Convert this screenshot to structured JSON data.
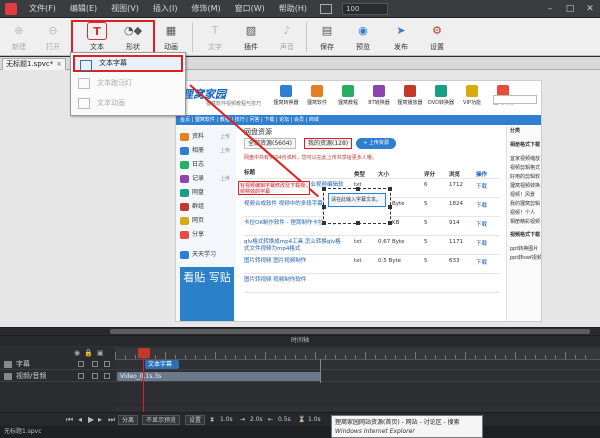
{
  "menubar": {
    "items": [
      "文件(F)",
      "编辑(E)",
      "视图(V)",
      "插入(I)",
      "修饰(M)",
      "窗口(W)",
      "帮助(H)"
    ],
    "zoom": "100"
  },
  "toolbar": {
    "new_label": "新建",
    "open_label": "打开",
    "text_label": "文本",
    "shape_label": "形状",
    "anim_label": "动画",
    "font_label": "文字",
    "image_label": "插件",
    "audio_label": "声音",
    "save_label": "保存",
    "preview_label": "预览",
    "publish_label": "发布",
    "settings_label": "设置"
  },
  "doc_tab": {
    "name": "无标题1.spvc*"
  },
  "dropdown": {
    "items": [
      "文本字幕",
      "文本跑马灯",
      "文本动画"
    ]
  },
  "web": {
    "logo": "狸窝家园",
    "subtitle": "狸窝软件视频教程与技巧",
    "nav_icons": [
      "狸窝转换器",
      "狸窝软件",
      "狸窝教程",
      "BT转换器",
      "狸窝播放器",
      "DVD转换器",
      "VIP功能",
      "狸窝商城"
    ],
    "nav_bar": "首页  |  狸窝软件  |  教程  |  技巧  |  问答  |  下载  |  论坛  |  会员  |  商城",
    "sidebar": [
      {
        "label": "资料",
        "hint": "上传"
      },
      {
        "label": "相册",
        "hint": "上传"
      },
      {
        "label": "日志",
        "hint": ""
      },
      {
        "label": "记录",
        "hint": "上传"
      },
      {
        "label": "网盘",
        "hint": ""
      },
      {
        "label": "群组",
        "hint": ""
      },
      {
        "label": "网页",
        "hint": ""
      },
      {
        "label": "分享",
        "hint": ""
      },
      {
        "label": "天天学习",
        "hint": ""
      }
    ],
    "banner": "看贴 写贴",
    "main_title": "网盘资源",
    "tabs": [
      "全部资源(5604)",
      "我的资源(128)"
    ],
    "upload_label": "+ 上传资源",
    "notice": "网盘中共有5604份资料，您可以在此上传共享给更多人哦。",
    "table_headers": [
      "标题",
      "类型",
      "大小",
      "评分",
      "浏览",
      "操作"
    ],
    "rows": [
      {
        "name": "免费视频编辑软件[狸窝] 专业视频编辑软件/视频编辑软件",
        "type": "txt",
        "size": "",
        "rate": "6",
        "views": "1712",
        "op": "下载"
      },
      {
        "name": "视频合成软件 视频中的多段字幕编辑",
        "type": "txt",
        "size": "0.65 Byte",
        "rate": "5",
        "views": "1824",
        "op": "下载"
      },
      {
        "name": "卡拉OK制作软件 - 狸窝制作卡拉OK字幕",
        "type": "txt",
        "size": "2.17 KB",
        "rate": "5",
        "views": "914",
        "op": "下载"
      },
      {
        "name": "qlv格式转换成mp4工具 怎么转换qlv格式文件视频为mp4格式",
        "type": "txt",
        "size": "0.67 Byte",
        "rate": "5",
        "views": "1171",
        "op": "下载"
      },
      {
        "name": "图片转视频 图片视频制作",
        "type": "txt",
        "size": "0.5 Byte",
        "rate": "5",
        "views": "633",
        "op": "下载"
      },
      {
        "name": "图片转视频 视频制作软件",
        "type": "",
        "size": "",
        "rate": "",
        "views": "",
        "op": ""
      }
    ],
    "right_title": "分类",
    "right_lines": [
      "相册格式下载",
      "宜家视频缩放",
      "视频剪辑格式",
      "好用的剪辑软",
      "狸窝视频转换",
      "视频！风景",
      "我的狸窝剪辑",
      "视频！个人",
      "相册精彩视频",
      "视频格式下载",
      "ppt转换图片",
      "ppt转swf视频"
    ]
  },
  "overlay": {
    "red_text": "有视频编辑字幕修改及下载视频特效的字幕",
    "caption_text": "请在此输入字幕文本。"
  },
  "timeline": {
    "title": "时间轴",
    "tracks": [
      "字幕",
      "视频/音频"
    ],
    "clip_caption": "文本字幕",
    "clip_video": "Video_0.1s.3s",
    "controls": [
      "分离",
      "不显示预览",
      "设置"
    ],
    "values": [
      "1.0s",
      "2.0s",
      "0.5s",
      "1.0s"
    ]
  },
  "statusbar": {
    "text": "无标题1.spvc"
  },
  "tooltip": {
    "line1": "狸窝家园网站资源(首页) - 网站 - 讨论区 - 搜索",
    "line2": "Windows Internet Explorer"
  },
  "colors": {
    "highlight_red": "#e02020",
    "accent_blue": "#2f7fd1",
    "dark_bg": "#2b2d31"
  }
}
